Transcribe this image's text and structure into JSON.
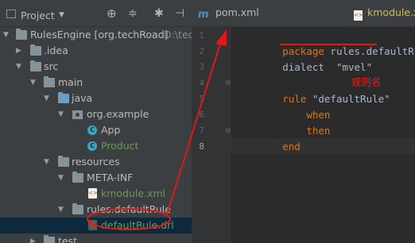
{
  "panel": {
    "title": "Project",
    "icons": [
      "project-view-icon",
      "dropdown-arrow-icon",
      "target-icon",
      "collapse-icon",
      "gear-icon",
      "hide-icon"
    ]
  },
  "tree": [
    {
      "label": "RulesEngine [org.techRoad]",
      "hint": "D:\\tec",
      "depth": 0,
      "expanded": true,
      "icon": "module-folder-icon"
    },
    {
      "label": ".idea",
      "depth": 1,
      "expanded": false,
      "icon": "folder-icon"
    },
    {
      "label": "src",
      "depth": 1,
      "expanded": true,
      "icon": "folder-icon"
    },
    {
      "label": "main",
      "depth": 2,
      "expanded": true,
      "icon": "folder-icon"
    },
    {
      "label": "java",
      "depth": 3,
      "expanded": true,
      "icon": "source-folder-icon"
    },
    {
      "label": "org.example",
      "depth": 4,
      "expanded": true,
      "icon": "package-icon"
    },
    {
      "label": "App",
      "depth": 5,
      "icon": "class-icon"
    },
    {
      "label": "Product",
      "depth": 5,
      "icon": "class-icon",
      "color": "#6a9a55"
    },
    {
      "label": "resources",
      "depth": 3,
      "expanded": true,
      "icon": "resources-folder-icon"
    },
    {
      "label": "META-INF",
      "depth": 4,
      "expanded": true,
      "icon": "folder-icon"
    },
    {
      "label": "kmodule.xml",
      "depth": 5,
      "icon": "xml-file-icon",
      "color": "#6a9a55"
    },
    {
      "label": "rules.defaultRule",
      "depth": 4,
      "expanded": true,
      "icon": "folder-icon"
    },
    {
      "label": "defaultRule.drl",
      "depth": 5,
      "icon": "drl-file-icon",
      "color": "#6a9a55",
      "selected": true
    },
    {
      "label": "test",
      "depth": 2,
      "expanded": false,
      "icon": "folder-icon"
    }
  ],
  "tabs": [
    {
      "label": "pom.xml",
      "icon": "maven-icon"
    },
    {
      "label": "kmodule.xml",
      "icon": "xml-file-icon"
    }
  ],
  "editor": {
    "lines": [
      {
        "num": "1",
        "segments": [
          {
            "t": "package",
            "c": "kw"
          },
          {
            "t": " rules.defaultRule;",
            "c": ""
          }
        ]
      },
      {
        "num": "2",
        "segments": [
          {
            "t": "dialect",
            "c": ""
          },
          {
            "t": "  \"mvel\"",
            "c": "str"
          }
        ]
      },
      {
        "num": "3",
        "segments": []
      },
      {
        "num": "4",
        "segments": [
          {
            "t": "rule",
            "c": "kw"
          },
          {
            "t": " \"defaultRule\"",
            "c": "str"
          }
        ]
      },
      {
        "num": "5",
        "segments": [
          {
            "t": "    when",
            "c": "kw"
          }
        ]
      },
      {
        "num": "6",
        "segments": [
          {
            "t": "    then",
            "c": "kw"
          }
        ]
      },
      {
        "num": "7",
        "segments": [
          {
            "t": "end",
            "c": "kw"
          }
        ]
      },
      {
        "num": "8",
        "segments": []
      }
    ]
  },
  "annotation": {
    "note": "规则名",
    "color": "#e02020"
  }
}
